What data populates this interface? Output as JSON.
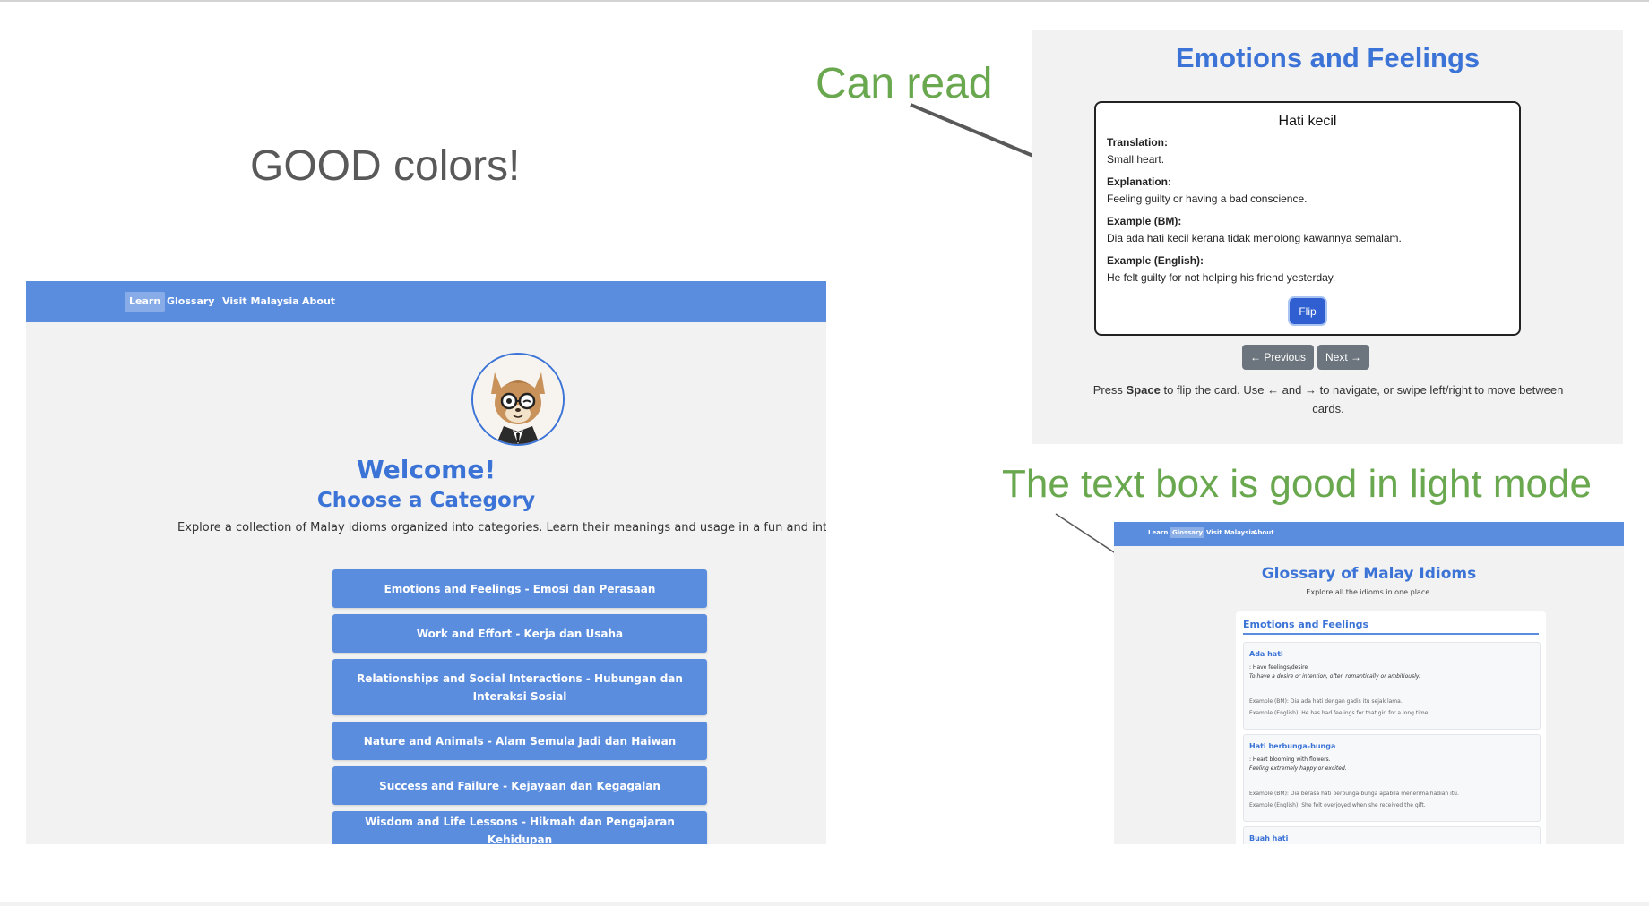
{
  "annotations": {
    "good_colors": "GOOD colors!",
    "can_read": "Can read",
    "text_box_good": "The text box is good in light mode"
  },
  "learn_page": {
    "nav": [
      "Learn",
      "Glossary",
      "Visit Malaysia",
      "About"
    ],
    "active_nav": "Learn",
    "welcome": "Welcome!",
    "choose": "Choose a Category",
    "description": "Explore a collection of Malay idioms organized into categories. Learn their meanings and usage in a fun and interactive",
    "categories": [
      "Emotions and Feelings - Emosi dan Perasaan",
      "Work and Effort - Kerja dan Usaha",
      "Relationships and Social Interactions - Hubungan dan Interaksi Sosial",
      "Nature and Animals - Alam Semula Jadi dan Haiwan",
      "Success and Failure - Kejayaan dan Kegagalan",
      "Wisdom and Life Lessons - Hikmah dan Pengajaran Kehidupan"
    ],
    "colors": {
      "navbar": "#5b8ddf",
      "accent": "#3b73d6",
      "background": "#f2f2f2"
    }
  },
  "flashcard_page": {
    "title": "Emotions and Feelings",
    "card": {
      "idiom": "Hati kecil",
      "translation_label": "Translation:",
      "translation": "Small heart.",
      "explanation_label": "Explanation:",
      "explanation": "Feeling guilty or having a bad conscience.",
      "example_bm_label": "Example (BM):",
      "example_bm": "Dia ada hati kecil kerana tidak menolong kawannya semalam.",
      "example_en_label": "Example (English):",
      "example_en": "He felt guilty for not helping his friend yesterday."
    },
    "flip_label": "Flip",
    "previous_label": "← Previous",
    "next_label": "Next →",
    "hint_pre": "Press ",
    "hint_key": "Space",
    "hint_post": " to flip the card. Use ← and → to navigate, or swipe left/right to move between cards."
  },
  "glossary_page": {
    "nav": [
      "Learn",
      "Glossary",
      "Visit Malaysia",
      "About"
    ],
    "active_nav": "Glossary",
    "title": "Glossary of Malay Idioms",
    "subtitle": "Explore all the idioms in one place.",
    "category": "Emotions and Feelings",
    "entries": [
      {
        "name": "Ada hati",
        "meaning": ": Have feelings/desire",
        "explanation": "To have a desire or intention, often romantically or ambitiously.",
        "example_bm": "Example (BM): Dia ada hati dengan gadis itu sejak lama.",
        "example_en": "Example (English): He has had feelings for that girl for a long time."
      },
      {
        "name": "Hati berbunga-bunga",
        "meaning": ": Heart blooming with flowers.",
        "explanation": "Feeling extremely happy or excited.",
        "example_bm": "Example (BM): Dia berasa hati berbunga-bunga apabila menerima hadiah itu.",
        "example_en": "Example (English): She felt overjoyed when she received the gift."
      },
      {
        "name": "Buah hati"
      }
    ]
  }
}
